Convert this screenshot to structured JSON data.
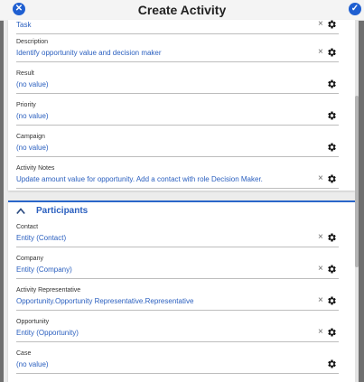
{
  "header": {
    "title": "Create Activity",
    "close_icon": "close-icon",
    "confirm_icon": "checkmark-icon"
  },
  "fields_top": [
    {
      "label": "",
      "value": "Task",
      "clearable": true
    },
    {
      "label": "Description",
      "value": "Identify opportunity value and decision maker",
      "clearable": true
    },
    {
      "label": "Result",
      "value": "(no value)",
      "clearable": false
    },
    {
      "label": "Priority",
      "value": "(no value)",
      "clearable": false
    },
    {
      "label": "Campaign",
      "value": "(no value)",
      "clearable": false
    },
    {
      "label": "Activity Notes",
      "value": "Update amount value for opportunity. Add a contact with role Decision Maker.",
      "clearable": true
    }
  ],
  "participants": {
    "title": "Participants",
    "fields": [
      {
        "label": "Contact",
        "value": "Entity (Contact)",
        "clearable": true
      },
      {
        "label": "Company",
        "value": "Entity (Company)",
        "clearable": true
      },
      {
        "label": "Activity Representative",
        "value": "Opportunity.Opportunity Representative.Representative",
        "clearable": true
      },
      {
        "label": "Opportunity",
        "value": "Entity (Opportunity)",
        "clearable": true
      },
      {
        "label": "Case",
        "value": "(no value)",
        "clearable": false
      }
    ]
  },
  "icons": {
    "clear": "×",
    "settings": "gear-icon",
    "collapse": "chevron-up-icon"
  },
  "colors": {
    "accent": "#2a5fbf",
    "header_bg": "#f4f4f4",
    "button_blue": "#1f5fd1"
  }
}
